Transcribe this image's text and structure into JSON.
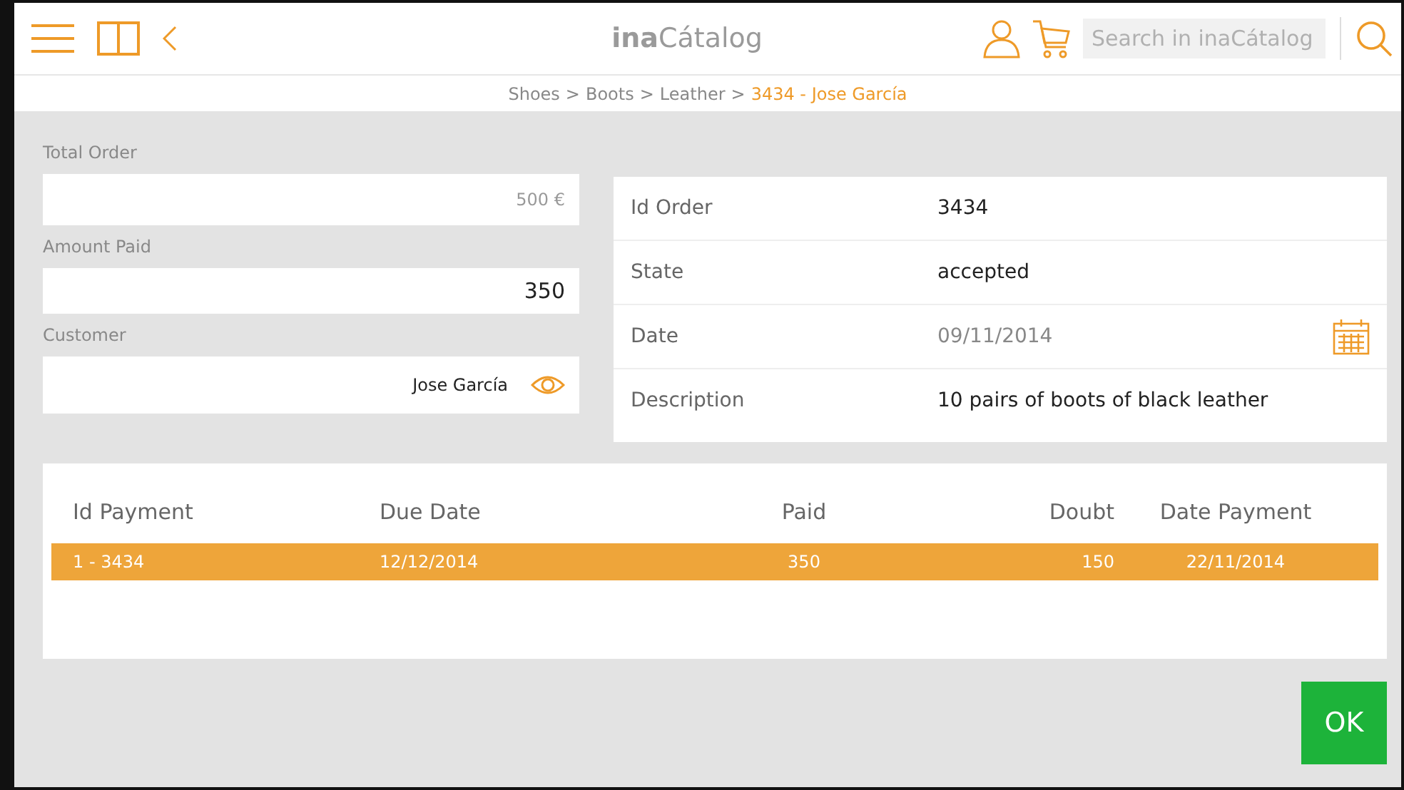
{
  "header": {
    "title_bold": "ina",
    "title_rest": "Cátalog",
    "search": {
      "placeholder": "Search in inaCátalog"
    }
  },
  "breadcrumb_separator": ">",
  "breadcrumb": [
    {
      "label": "Shoes",
      "current": false
    },
    {
      "label": "Boots",
      "current": false
    },
    {
      "label": "Leather",
      "current": false
    },
    {
      "label": "3434 - Jose García",
      "current": true
    }
  ],
  "form": [
    {
      "label": "Total Order",
      "value": "500 €",
      "kind": "muted"
    },
    {
      "label": "Amount Paid",
      "value": "350",
      "kind": "input"
    },
    {
      "label": "Customer",
      "value": "Jose García",
      "kind": "link"
    }
  ],
  "details": [
    {
      "label": "Id Order",
      "value": "3434",
      "kind": "plain"
    },
    {
      "label": "State",
      "value": "accepted",
      "kind": "strong"
    },
    {
      "label": "Date",
      "value": "09/11/2014",
      "kind": "date"
    },
    {
      "label": "Description",
      "value": "10 pairs of boots of black leather",
      "kind": "strong"
    }
  ],
  "payments": {
    "columns": [
      "Id Payment",
      "Due Date",
      "Paid",
      "Doubt",
      "Date Payment"
    ],
    "rows": [
      {
        "cells": [
          "1 - 3434",
          "12/12/2014",
          "350",
          "150",
          "22/11/2014"
        ],
        "selected": true
      }
    ]
  },
  "buttons": [
    "OK"
  ]
}
